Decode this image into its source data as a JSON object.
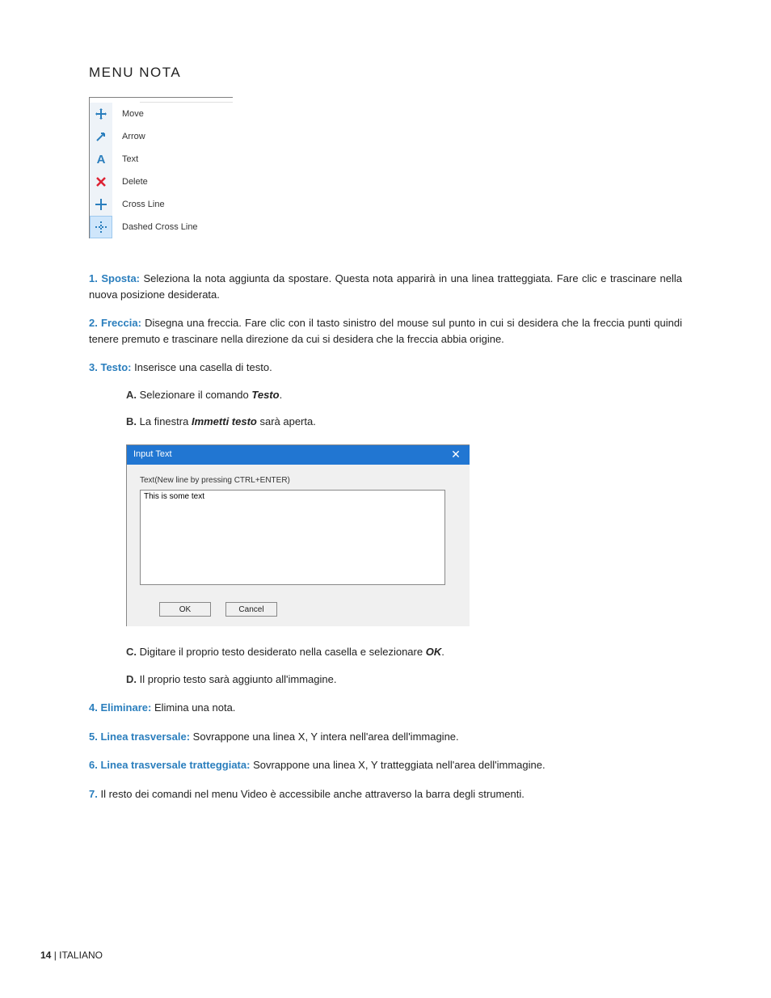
{
  "section_title": "MENU NOTA",
  "menu": {
    "items": [
      {
        "label": "Move",
        "icon": "move",
        "selected": false
      },
      {
        "label": "Arrow",
        "icon": "arrow",
        "selected": false
      },
      {
        "label": "Text",
        "icon": "text",
        "selected": false
      },
      {
        "label": "Delete",
        "icon": "delete",
        "selected": false
      },
      {
        "label": "Cross Line",
        "icon": "cross",
        "selected": false
      },
      {
        "label": "Dashed Cross Line",
        "icon": "dashed-cross",
        "selected": true
      }
    ]
  },
  "list": {
    "items": [
      {
        "num": "1.",
        "label": "Sposta:",
        "text": "Seleziona la nota aggiunta da spostare. Questa nota apparirà in una linea tratteggiata. Fare clic e trascinare nella nuova posizione desiderata."
      },
      {
        "num": "2.",
        "label": "Freccia:",
        "text": "Disegna una freccia. Fare clic con il tasto sinistro del mouse sul punto in cui si desidera che la freccia punti quindi tenere premuto e trascinare nella direzione da cui si desidera che la freccia abbia origine."
      },
      {
        "num": "3.",
        "label": "Testo:",
        "text": "Inserisce una casella di testo.",
        "sub": [
          {
            "letter": "A.",
            "pre": "Selezionare il comando ",
            "bold": "Testo",
            "post": "."
          },
          {
            "letter": "B.",
            "pre": "La finestra ",
            "bold": "Immetti testo",
            "post": " sarà aperta."
          }
        ],
        "sub_after": [
          {
            "letter": "C.",
            "pre": "Digitare il proprio testo desiderato nella casella e selezionare ",
            "bold": "OK",
            "post": "."
          },
          {
            "letter": "D.",
            "pre": "Il proprio testo sarà aggiunto all'immagine.",
            "bold": "",
            "post": ""
          }
        ]
      },
      {
        "num": "4.",
        "label": "Eliminare:",
        "text": "Elimina una nota."
      },
      {
        "num": "5.",
        "label": "Linea trasversale:",
        "text": "Sovrappone una linea X, Y intera nell'area dell'immagine."
      },
      {
        "num": "6.",
        "label": "Linea trasversale tratteggiata:",
        "text": "Sovrappone una linea X, Y tratteggiata nell'area dell'immagine."
      },
      {
        "num": "7.",
        "label": "",
        "text": "Il resto dei comandi nel menu Video è accessibile anche attraverso la barra degli strumenti."
      }
    ]
  },
  "dialog": {
    "title": "Input Text",
    "hint": "Text(New line by pressing CTRL+ENTER)",
    "value": "This is some text",
    "ok": "OK",
    "cancel": "Cancel",
    "close": "✕"
  },
  "footer": {
    "page": "14",
    "sep": " | ",
    "lang": "ITALIANO"
  }
}
